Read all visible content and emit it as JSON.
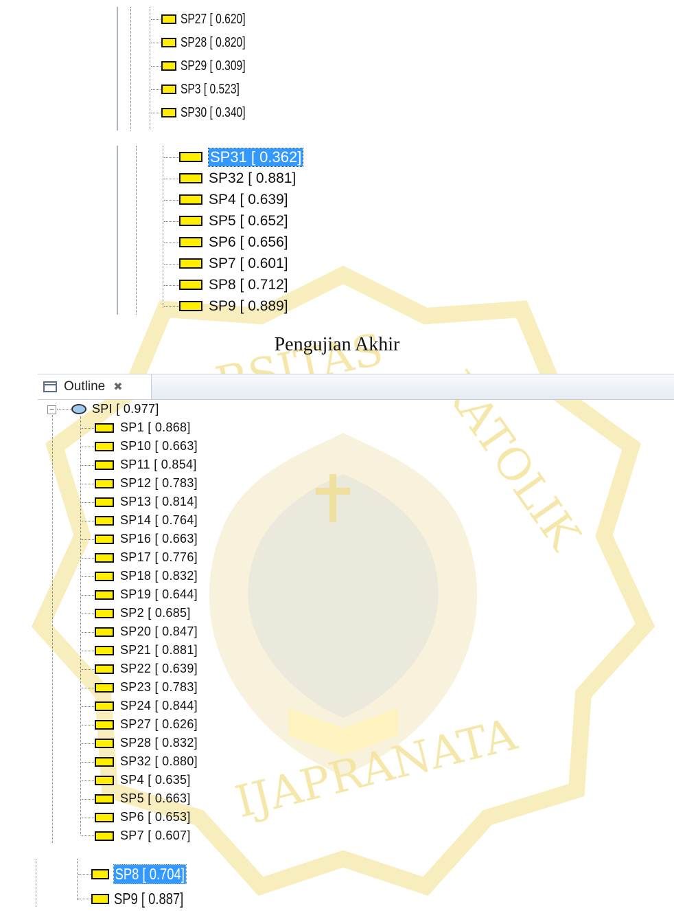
{
  "panel_top": {
    "items": [
      {
        "label": "SP27 [ 0.620]"
      },
      {
        "label": "SP28 [ 0.820]"
      },
      {
        "label": "SP29 [ 0.309]"
      },
      {
        "label": "SP3 [ 0.523]"
      },
      {
        "label": "SP30 [ 0.340]"
      }
    ]
  },
  "panel_mid": {
    "items": [
      {
        "label": "SP31 [ 0.362]",
        "selected": true
      },
      {
        "label": "SP32 [ 0.881]"
      },
      {
        "label": "SP4 [ 0.639]"
      },
      {
        "label": "SP5 [ 0.652]"
      },
      {
        "label": "SP6 [ 0.656]"
      },
      {
        "label": "SP7 [ 0.601]"
      },
      {
        "label": "SP8 [ 0.712]"
      },
      {
        "label": "SP9 [ 0.889]"
      }
    ]
  },
  "caption": "Pengujian Akhir",
  "outline": {
    "tab_title": "Outline",
    "close_glyph": "✖",
    "expander_glyph": "−",
    "root_label": "SPI [ 0.977]",
    "items": [
      {
        "label": "SP1 [ 0.868]"
      },
      {
        "label": "SP10 [ 0.663]"
      },
      {
        "label": "SP11 [ 0.854]"
      },
      {
        "label": "SP12 [ 0.783]"
      },
      {
        "label": "SP13 [ 0.814]"
      },
      {
        "label": "SP14 [ 0.764]"
      },
      {
        "label": "SP16 [ 0.663]"
      },
      {
        "label": "SP17 [ 0.776]"
      },
      {
        "label": "SP18 [ 0.832]"
      },
      {
        "label": "SP19 [ 0.644]"
      },
      {
        "label": "SP2 [ 0.685]"
      },
      {
        "label": "SP20 [ 0.847]"
      },
      {
        "label": "SP21 [ 0.881]"
      },
      {
        "label": "SP22 [ 0.639]"
      },
      {
        "label": "SP23 [ 0.783]"
      },
      {
        "label": "SP24 [ 0.844]"
      },
      {
        "label": "SP27 [ 0.626]"
      },
      {
        "label": "SP28 [ 0.832]"
      },
      {
        "label": "SP32 [ 0.880]"
      },
      {
        "label": "SP4 [ 0.635]"
      },
      {
        "label": "SP5 [ 0.663]"
      },
      {
        "label": "SP6 [ 0.653]"
      },
      {
        "label": "SP7 [ 0.607]"
      }
    ]
  },
  "panel_bottom": {
    "items": [
      {
        "label": "SP8 [ 0.704]",
        "selected": true
      },
      {
        "label": "SP9 [ 0.887]"
      }
    ]
  },
  "watermark": {
    "text_top": "RSITAS",
    "text_right": "KATOLIK",
    "text_bottom": "IJAPRANATA",
    "color": "#f3e39a"
  },
  "colors": {
    "node_fill": "#ffee00",
    "selection": "#3399ff",
    "root_icon": "#9ec9ee"
  }
}
